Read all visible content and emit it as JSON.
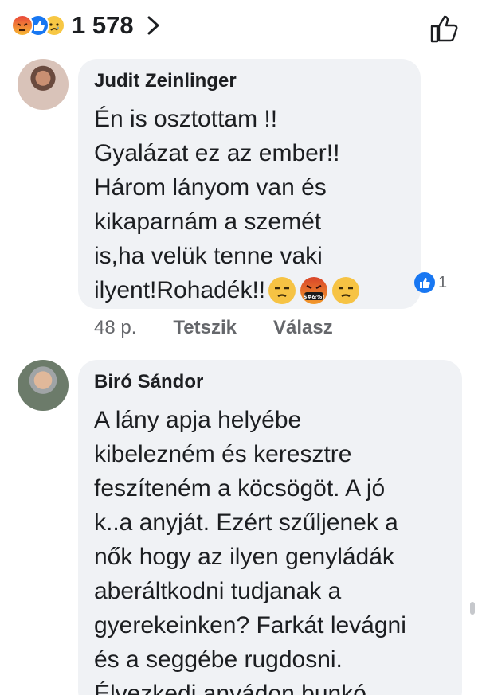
{
  "topbar": {
    "reaction_count": "1 578",
    "reaction_icons": [
      "angry-icon",
      "like-icon",
      "sad-icon"
    ]
  },
  "comments": [
    {
      "author": "Judit Zeinlinger",
      "text": "Én is osztottam !!\nGyalázat ez az ember!!\nHárom lányom van és\nkikaparnám a szemét\nis,ha  velük tenne vaki\nilyent!Rohadék!!",
      "emojis": [
        "unamused-face-icon",
        "face-with-symbols-icon",
        "unamused-face-icon"
      ],
      "emoji_symbols": "$#&%!",
      "reaction_count": "1",
      "time": "48 p.",
      "like_label": "Tetszik",
      "reply_label": "Válasz"
    },
    {
      "author": "Biró Sándor",
      "text": "A lány apja helyébe\nkibelezném és keresztre\nfeszíteném a köcsögöt. A jó\nk..a anyját. Ezért szűljenek a\nnők hogy az ilyen genyládák\naberáltkodni tudjanak a\ngyerekeinken? Farkát levágni\nés a seggébe rugdosni.\nÉlvezkedj anyádon bunkó."
    }
  ],
  "colors": {
    "bubble": "#f0f2f5",
    "meta_text": "#65676b",
    "like_blue": "#1877f2"
  }
}
